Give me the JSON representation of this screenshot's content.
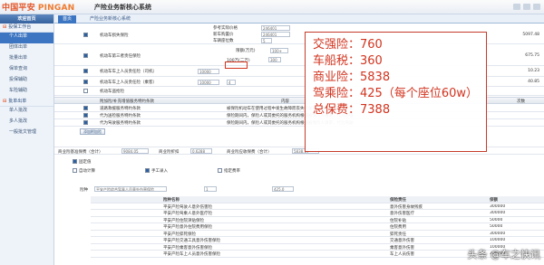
{
  "header": {
    "logo_cn": "中国平安",
    "logo_en": "PINGAN",
    "system_title": "产险业务新核心系统"
  },
  "sidebar": {
    "head": "欢迎首页",
    "sections": [
      {
        "label": "投保工作台",
        "items": [
          "个人出单",
          "团体出单",
          "批量出单",
          "保单查询",
          "投保辅助",
          "车险辅助"
        ],
        "active": 0
      },
      {
        "label": "批单出单",
        "items": [
          "单人批改",
          "多人批改",
          "一般批文管理"
        ],
        "active": -1
      }
    ]
  },
  "tabs": [
    "首页",
    "产险业务新核心系统"
  ],
  "form": {
    "price_label": "参考实际价格",
    "price_val": "246401",
    "value_label": "新车购置价",
    "value_val": "246401",
    "seat_label": "车辆座位数",
    "seat_val": "5",
    "rows": [
      {
        "label": "机动车损失保险",
        "amount": "5097.48"
      },
      {
        "label": "机动车第三者责任保险",
        "amount": "675.75"
      },
      {
        "label": "机动车车上人员责任险（司机）",
        "amount": "10.23"
      },
      {
        "label": "机动车车上人员责任险（乘客）",
        "amount": "40.85"
      },
      {
        "label": "机动车盗抢险",
        "amount": ""
      }
    ],
    "limit_label": "限额(万元)",
    "limit_val": "100+",
    "limit_pct_label": "100万(二万)",
    "limit_pct_val": "300",
    "driver_val": "10000",
    "passenger_val": "10000",
    "passenger_seats": "4"
  },
  "extra": {
    "header": [
      "附加险/补充增值服务特约条款",
      "内容",
      "次数"
    ],
    "rows": [
      {
        "label": "道路救援服务特约条款",
        "desc": "被保险机动车在使用过程中发生故障而丧失行驶能力时，保险人或其委托的服务机构提供道路救援服务。"
      },
      {
        "label": "代为送检服务特约条款",
        "desc": "保险期间内，保险人或其委托的服务机构根据被保险人请求，代为办理车辆年检。"
      },
      {
        "label": "代为驾驶服务特约条款",
        "desc": "保险期间内，保险人或其委托的服务机构根据被保险人请求，代为驾驶被保险机动车。"
      }
    ],
    "add_btn": "添加附加险"
  },
  "summary": {
    "premium_label": "商业险基准保费（合计）",
    "premium_val": "9084.05",
    "rate_label": "商业险折扣",
    "rate_val": "0.6288",
    "final_label": "商业险应收保费（合计）",
    "final_val": "5838.19"
  },
  "options": [
    "固定值",
    "自动计算",
    "手工录入",
    "指定费率"
  ],
  "filter": {
    "label": "险种",
    "select": "平安产险综合驾乘人员意外伤害保险",
    "pages": "1",
    "total": "425.0"
  },
  "sub_table": {
    "headers": [
      "险种名称",
      "保险责任",
      "保额"
    ],
    "rows": [
      [
        "平安产险驾驶人意外伤害险",
        "意外伤害身故残疾",
        "300000"
      ],
      [
        "平安产险驾乘人意外医疗险",
        "意外伤害医疗",
        "300000"
      ],
      [
        "平安产险住院津贴保险",
        "住院补贴",
        "50000"
      ],
      [
        "平安产险意外住院费用保险",
        "住院费用",
        "50000"
      ],
      [
        "平安产险猝死保险",
        "猝死责任",
        "300000"
      ],
      [
        "平安产险交通工具意外伤害保险",
        "交通意外伤害",
        "100000"
      ],
      [
        "平安产险乘客意外伤害保险",
        "乘客意外伤害",
        "100000"
      ],
      [
        "平安产险车上人员意外伤害保险",
        "车上人员伤害",
        "300000"
      ]
    ]
  },
  "overlay": {
    "lines": [
      "交强险：760",
      "车船税：360",
      "商业险：5838",
      "驾乘险：425（每个座位60w）",
      "总保费：7388"
    ],
    "accent": "#d2341f"
  },
  "watermark": "头条 @车之快讯"
}
